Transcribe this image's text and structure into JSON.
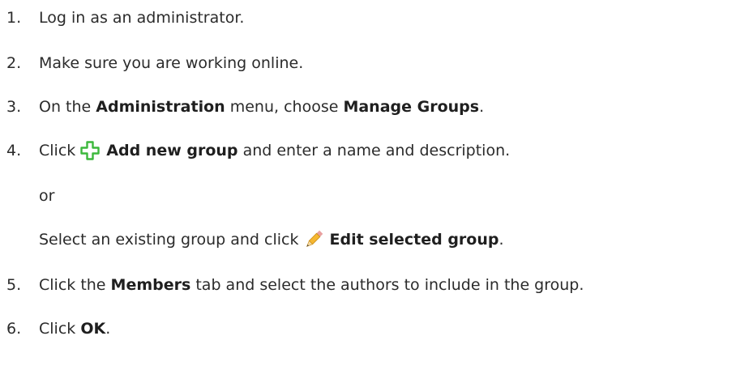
{
  "steps": [
    {
      "num": "1.",
      "text": "Log in as an administrator."
    },
    {
      "num": "2.",
      "text": "Make sure you are working online."
    },
    {
      "num": "3.",
      "pre": "On the ",
      "bold1": "Administration",
      "mid": " menu, choose ",
      "bold2": "Manage Groups",
      "post": "."
    },
    {
      "num": "4.",
      "pre": "Click",
      "bold": "Add new group",
      "post": " and enter a name and description.",
      "icon": "add-plus-icon"
    },
    {
      "or": "or"
    },
    {
      "pre": "Select an existing group and click",
      "bold": "Edit selected group",
      "post": ".",
      "icon": "pencil-icon"
    },
    {
      "num": "5.",
      "pre": "Click the ",
      "bold": "Members",
      "post": " tab and select the authors to include in the group."
    },
    {
      "num": "6.",
      "pre": "Click ",
      "bold": "OK",
      "post": "."
    }
  ],
  "colors": {
    "text": "#2b2b2b",
    "plus_icon": "#3cb83c",
    "pencil_body": "#f5b731",
    "pencil_tip": "#e8a0a0"
  }
}
